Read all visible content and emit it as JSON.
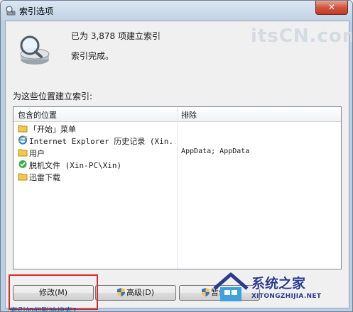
{
  "window": {
    "title": "索引选项",
    "close_label": "✕"
  },
  "status": {
    "count_text": "已为 3,878 项建立索引",
    "done_text": "索引完成。"
  },
  "section_label": "为这些位置建立索引:",
  "list": {
    "headers": {
      "included": "包含的位置",
      "excluded": "排除"
    },
    "rows": [
      {
        "icon": "folder-icon",
        "name": "「开始」菜单",
        "excluded": ""
      },
      {
        "icon": "ie-icon",
        "name": "Internet Explorer 历史记录 (Xin...",
        "excluded": ""
      },
      {
        "icon": "folder-icon",
        "name": "用户",
        "excluded": "AppData; AppData"
      },
      {
        "icon": "offline-files-icon",
        "name": "脱机文件 (Xin-PC\\Xin)",
        "excluded": ""
      },
      {
        "icon": "folder-icon",
        "name": "迅雷下载",
        "excluded": ""
      }
    ]
  },
  "buttons": {
    "modify": "修改(M)",
    "advanced": "高级(D)",
    "pause": "暂停(P)"
  },
  "help_link": "索引如何影响搜索?",
  "watermarks": {
    "top": "itsCN.com",
    "logo_main": "系统之家",
    "logo_sub": "XITONGZHIJIA.NET"
  },
  "colors": {
    "highlight": "#d52a2a",
    "link": "#0c4ea2",
    "logo": "#2b3b8f"
  }
}
